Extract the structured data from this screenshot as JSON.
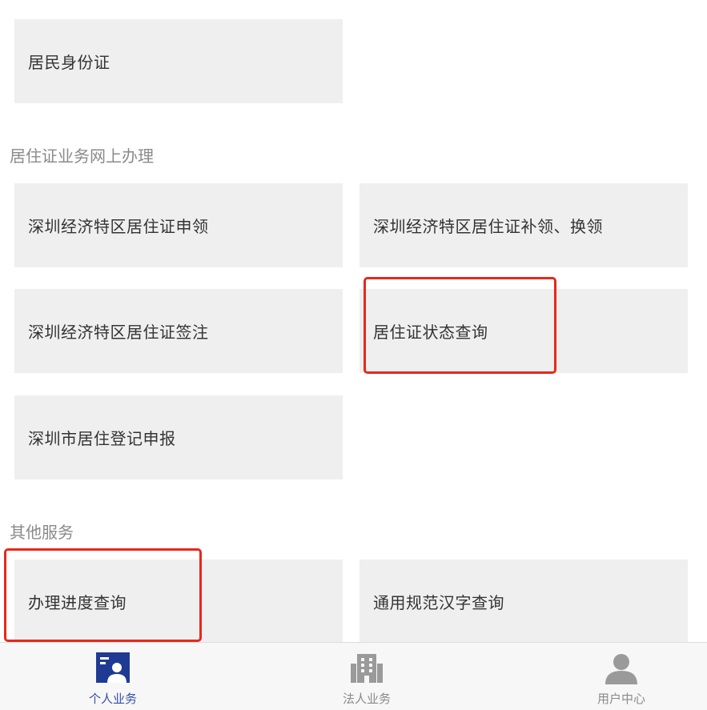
{
  "top_tiles": [
    {
      "label": "居民身份证"
    }
  ],
  "sections": [
    {
      "title": "居住证业务网上办理",
      "items": [
        {
          "label": "深圳经济特区居住证申领"
        },
        {
          "label": "深圳经济特区居住证补领、换领"
        },
        {
          "label": "深圳经济特区居住证签注"
        },
        {
          "label": "居住证状态查询",
          "highlighted": true
        },
        {
          "label": "深圳市居住登记申报"
        }
      ]
    },
    {
      "title": "其他服务",
      "items": [
        {
          "label": "办理进度查询",
          "highlighted": true
        },
        {
          "label": "通用规范汉字查询"
        }
      ]
    }
  ],
  "tabbar": {
    "tabs": [
      {
        "label": "个人业务",
        "icon": "person-card-icon",
        "active": true
      },
      {
        "label": "法人业务",
        "icon": "building-icon",
        "active": false
      },
      {
        "label": "用户中心",
        "icon": "user-icon",
        "active": false
      }
    ]
  },
  "colors": {
    "highlight": "#e8271c",
    "tile_bg": "#efefef",
    "active_tab": "#1f3a93",
    "inactive_icon": "#9a9a9a"
  }
}
